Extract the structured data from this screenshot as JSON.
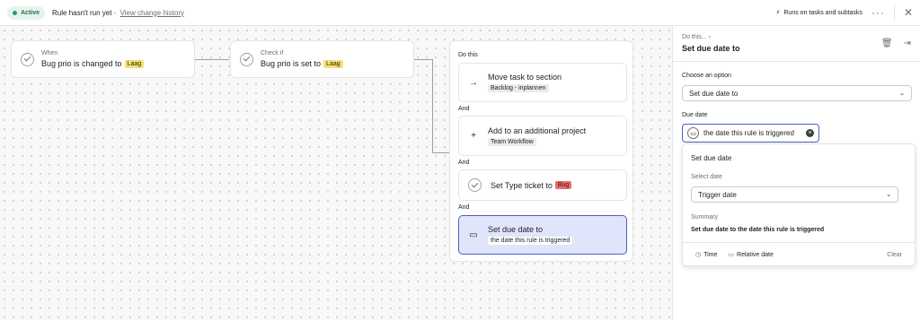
{
  "topbar": {
    "status_badge": "Active",
    "status_text": "Rule hasn't run yet · ",
    "history_link": "View change history",
    "runs_on": "Runs on tasks and subtasks",
    "more_icon": "more-horizontal-icon",
    "close_icon": "close-icon"
  },
  "flow": {
    "trigger": {
      "label": "When",
      "text": "Bug prio is changed to",
      "tag": "Laag"
    },
    "check": {
      "label": "Check if",
      "text": "Bug prio is set to",
      "tag": "Laag"
    },
    "actions_title": "Do this",
    "and_label": "And",
    "actions": [
      {
        "title": "Move task to section",
        "detail": "Backlog - inplannen",
        "icon": "arrow-right-icon"
      },
      {
        "title": "Add to an additional project",
        "detail": "Team Workflow",
        "icon": "plus-icon"
      },
      {
        "title": "Set Type ticket to",
        "tag": "Bug",
        "icon": "check-circle-icon"
      },
      {
        "title": "Set due date to",
        "detail": "the date this rule is triggered",
        "icon": "calendar-icon"
      }
    ]
  },
  "panel": {
    "breadcrumb": "Do this...",
    "title": "Set due date to",
    "choose_label": "Choose an option",
    "option_value": "Set due date to",
    "due_date_label": "Due date",
    "due_date_value": "the date this rule is triggered",
    "popup": {
      "title": "Set due date",
      "select_date_label": "Select date",
      "select_date_value": "Trigger date",
      "summary_label": "Summary",
      "summary_text": "Set due date to the date this rule is triggered",
      "time_button": "Time",
      "relative_button": "Relative date",
      "clear_button": "Clear"
    }
  },
  "colors": {
    "accent": "#4d5fc0",
    "active_badge": "#e6f4ee",
    "tag_yellow": "#f8df72",
    "tag_red": "#f06a6a",
    "selected_action": "#e1e5fb"
  }
}
